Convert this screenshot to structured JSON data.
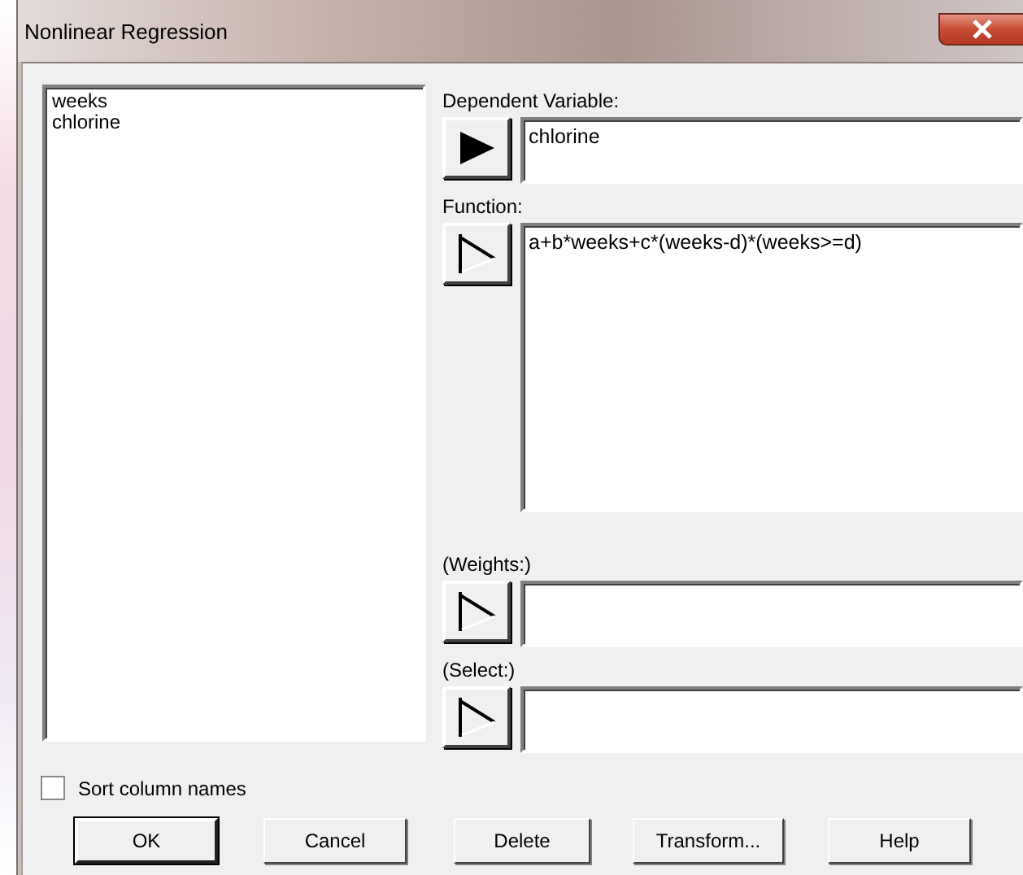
{
  "window": {
    "title": "Nonlinear Regression"
  },
  "columns": [
    "weeks",
    "chlorine"
  ],
  "fields": [
    {
      "label": "Dependent Variable:",
      "value": "chlorine",
      "kind": "line",
      "arrow_active": true
    },
    {
      "label": "Function:",
      "value": "a+b*weeks+c*(weeks-d)*(weeks>=d)",
      "kind": "multiline",
      "arrow_active": false
    },
    {
      "label": "(Weights:)",
      "kind": "line",
      "arrow_active": false
    },
    {
      "label": "(Select:)",
      "kind": "line",
      "arrow_active": false
    }
  ],
  "sort_column_names": {
    "label": "Sort column names",
    "checked": false
  },
  "buttons": [
    {
      "label": "OK",
      "default": true
    },
    {
      "label": "Cancel",
      "default": false
    },
    {
      "label": "Delete",
      "default": false
    },
    {
      "label": "Transform...",
      "default": false
    },
    {
      "label": "Help",
      "default": false
    }
  ]
}
